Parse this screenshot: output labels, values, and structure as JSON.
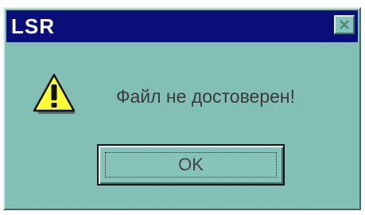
{
  "window": {
    "title": "LSR",
    "close_icon": "close-icon"
  },
  "dialog": {
    "icon": "warning-icon",
    "message": "Файл не достоверен!",
    "ok_label": "OK"
  },
  "colors": {
    "title_bar": "#0a0e78",
    "face": "#82bfb4",
    "warning_fill": "#ffff33"
  }
}
